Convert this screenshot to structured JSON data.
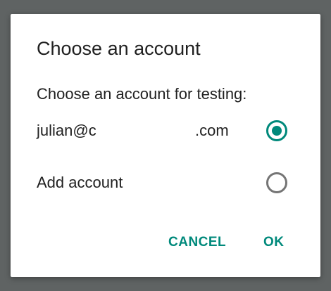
{
  "dialog": {
    "title": "Choose an account",
    "message": "Choose an account for testing:",
    "options": [
      {
        "label_prefix": "julian@c",
        "label_suffix": ".com",
        "selected": true
      },
      {
        "label": "Add account",
        "selected": false
      }
    ],
    "cancel_label": "CANCEL",
    "ok_label": "OK"
  },
  "colors": {
    "accent": "#00897b",
    "scrim": "#5f6363",
    "text": "#212121",
    "radio_unchecked": "#757575"
  }
}
